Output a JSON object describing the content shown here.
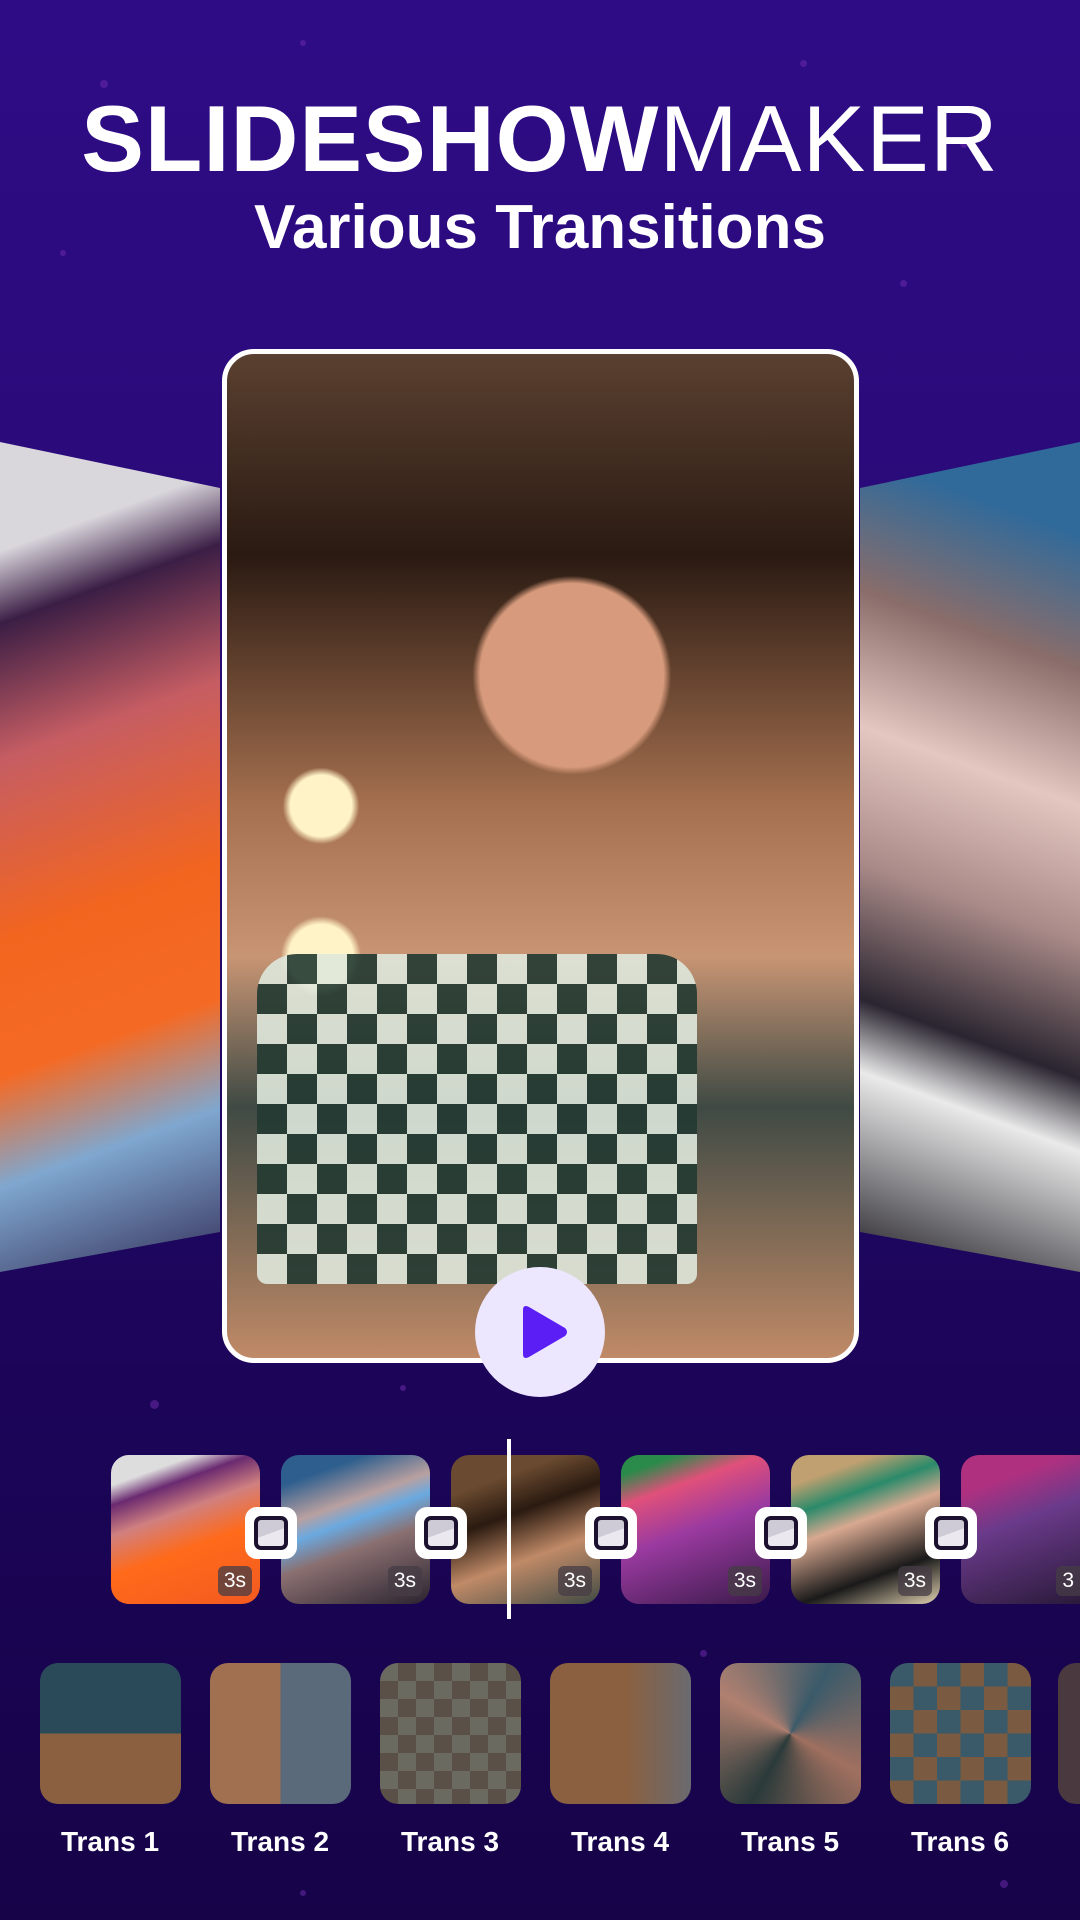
{
  "header": {
    "title_bold": "SLIDESHOW",
    "title_light": "MAKER",
    "subtitle": "Various Transitions"
  },
  "colors": {
    "background": "#2a0a78",
    "play_button_bg": "#ece6fe",
    "play_icon": "#5b1ff5",
    "card_border": "#ffffff"
  },
  "preview": {
    "play_icon": "play-icon"
  },
  "timeline": {
    "clips": [
      {
        "duration": "3s"
      },
      {
        "duration": "3s"
      },
      {
        "duration": "3s"
      },
      {
        "duration": "3s"
      },
      {
        "duration": "3s"
      },
      {
        "duration": "3"
      }
    ],
    "transition_icon": "transition-icon"
  },
  "transitions": [
    {
      "label": "Trans 1"
    },
    {
      "label": "Trans 2"
    },
    {
      "label": "Trans 3"
    },
    {
      "label": "Trans 4"
    },
    {
      "label": "Trans 5"
    },
    {
      "label": "Trans 6"
    }
  ]
}
